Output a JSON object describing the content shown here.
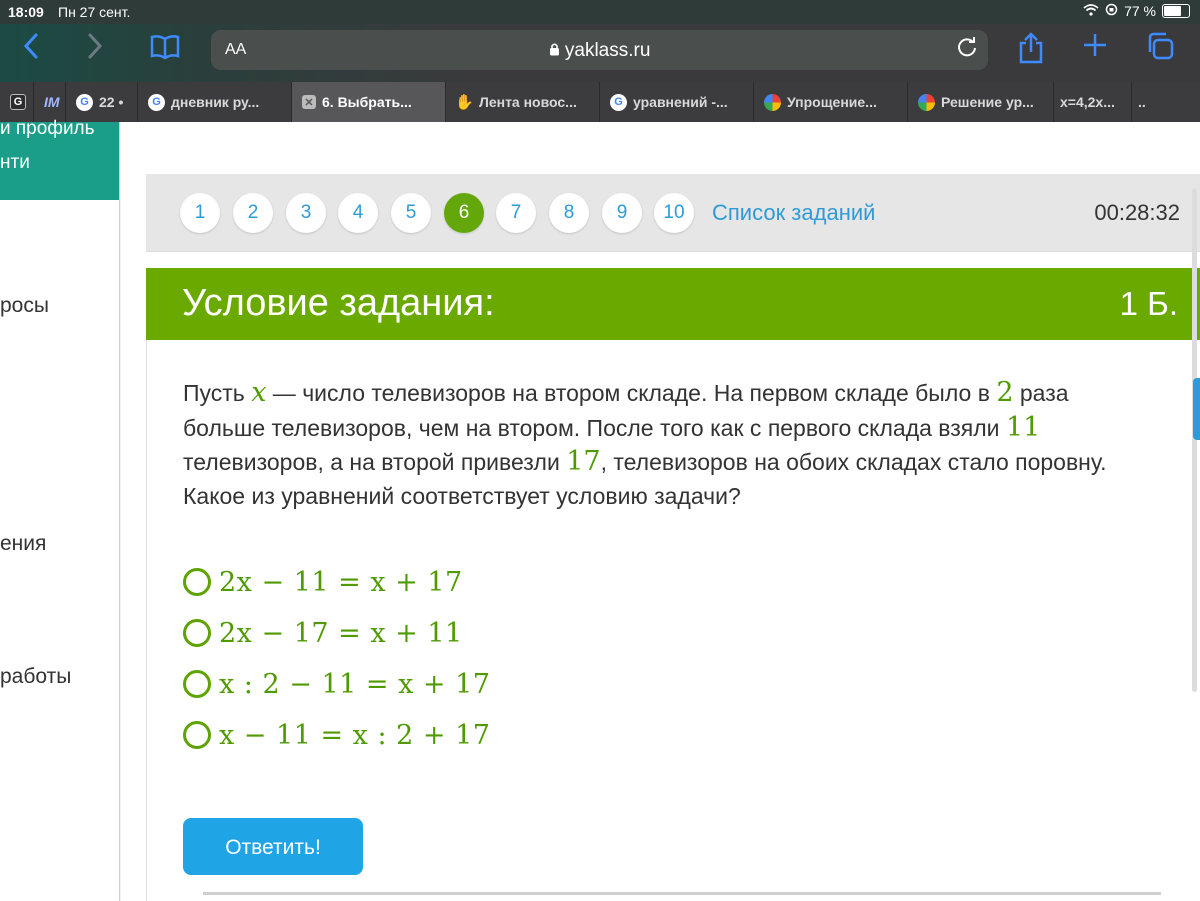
{
  "status_bar": {
    "time": "18:09",
    "date": "Пн 27 сент.",
    "battery": "77 %",
    "battery_level": 0.77
  },
  "toolbar": {
    "text_size": "AA",
    "url": "yaklass.ru"
  },
  "tabs": [
    {
      "label": "",
      "icon": "g-box-icon"
    },
    {
      "label": "",
      "icon": "im-icon"
    },
    {
      "label": "22 •",
      "icon": "google-icon"
    },
    {
      "label": "дневник ру...",
      "icon": "google-icon"
    },
    {
      "label": "6. Выбрать...",
      "icon": "close-icon",
      "active": true
    },
    {
      "label": "Лента новос...",
      "icon": "hand-icon"
    },
    {
      "label": "уравнений -...",
      "icon": "google-icon"
    },
    {
      "label": "Упрощение...",
      "icon": "multicolor-icon"
    },
    {
      "label": "Решение ур...",
      "icon": "multicolor-icon"
    },
    {
      "label": "x=4,2x...",
      "icon": ""
    },
    {
      "label": "..",
      "icon": ""
    }
  ],
  "sidebar": {
    "profile_line1": "и профиль",
    "profile_line2": "нти",
    "items": [
      "росы",
      "ения",
      "работы"
    ]
  },
  "task_nav": {
    "questions": [
      "1",
      "2",
      "3",
      "4",
      "5",
      "6",
      "7",
      "8",
      "9",
      "10"
    ],
    "current": "6",
    "task_list_label": "Список заданий",
    "timer": "00:28:32"
  },
  "condition": {
    "title": "Условие задания:",
    "points": "1 Б.",
    "text_parts": {
      "p1": "Пусть ",
      "var": "x",
      "p2": " — число телевизоров на втором складе. На первом складе было в ",
      "n1": "2",
      "p3": " раза больше телевизоров, чем на втором. После того как с первого склада взяли ",
      "n2": "11",
      "p4": " телевизоров, а на второй привезли ",
      "n3": "17",
      "p5": ", телевизоров на обоих складах стало поровну. Какое из уравнений соответствует условию задачи?"
    }
  },
  "options": [
    "2x − 11 = x + 17",
    "2x − 17 = x + 11",
    "x : 2 − 11 = x + 17",
    "x − 11 = x : 2 + 17"
  ],
  "submit_label": "Ответить!",
  "colors": {
    "accent_green": "#6aaa00",
    "link_blue": "#2d9bd8",
    "button_blue": "#1fa4e6",
    "sidebar_teal": "#1a9e8a"
  }
}
